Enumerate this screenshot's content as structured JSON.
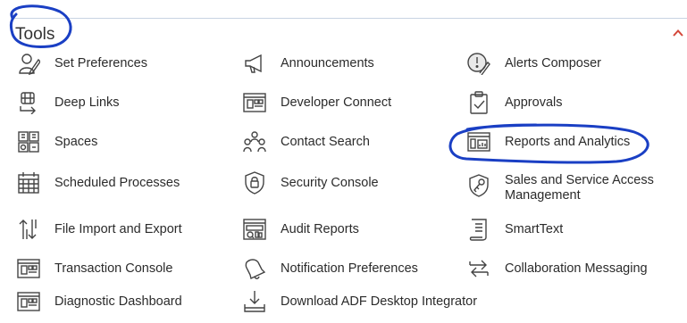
{
  "section": {
    "title": "Tools",
    "collapse_icon": "chevron-up-icon",
    "accent": "#d4473a",
    "annotation_color": "#1a3fc4"
  },
  "tools": [
    {
      "label": "Set Preferences",
      "icon": "user-pen-icon"
    },
    {
      "label": "Announcements",
      "icon": "megaphone-icon"
    },
    {
      "label": "Alerts Composer",
      "icon": "alert-pen-icon"
    },
    {
      "label": "Deep Links",
      "icon": "deep-links-icon"
    },
    {
      "label": "Developer Connect",
      "icon": "window-panel-icon"
    },
    {
      "label": "Approvals",
      "icon": "clipboard-check-icon"
    },
    {
      "label": "Spaces",
      "icon": "spaces-grid-icon"
    },
    {
      "label": "Contact Search",
      "icon": "contact-search-icon"
    },
    {
      "label": "Reports and Analytics",
      "icon": "report-chart-icon"
    },
    {
      "label": "Scheduled Processes",
      "icon": "calendar-icon"
    },
    {
      "label": "Security Console",
      "icon": "shield-lock-icon"
    },
    {
      "label": "Sales and Service Access Management",
      "icon": "shield-key-icon"
    },
    {
      "label": "File Import and Export",
      "icon": "import-export-icon"
    },
    {
      "label": "Audit Reports",
      "icon": "audit-report-icon"
    },
    {
      "label": "SmartText",
      "icon": "smarttext-document-icon"
    },
    {
      "label": "Transaction Console",
      "icon": "window-panel-icon"
    },
    {
      "label": "Notification Preferences",
      "icon": "bell-icon"
    },
    {
      "label": "Collaboration Messaging",
      "icon": "exchange-arrows-icon"
    },
    {
      "label": "Diagnostic Dashboard",
      "icon": "window-panel-icon"
    },
    {
      "label": "Download ADF Desktop Integrator",
      "icon": "download-tray-icon"
    }
  ]
}
